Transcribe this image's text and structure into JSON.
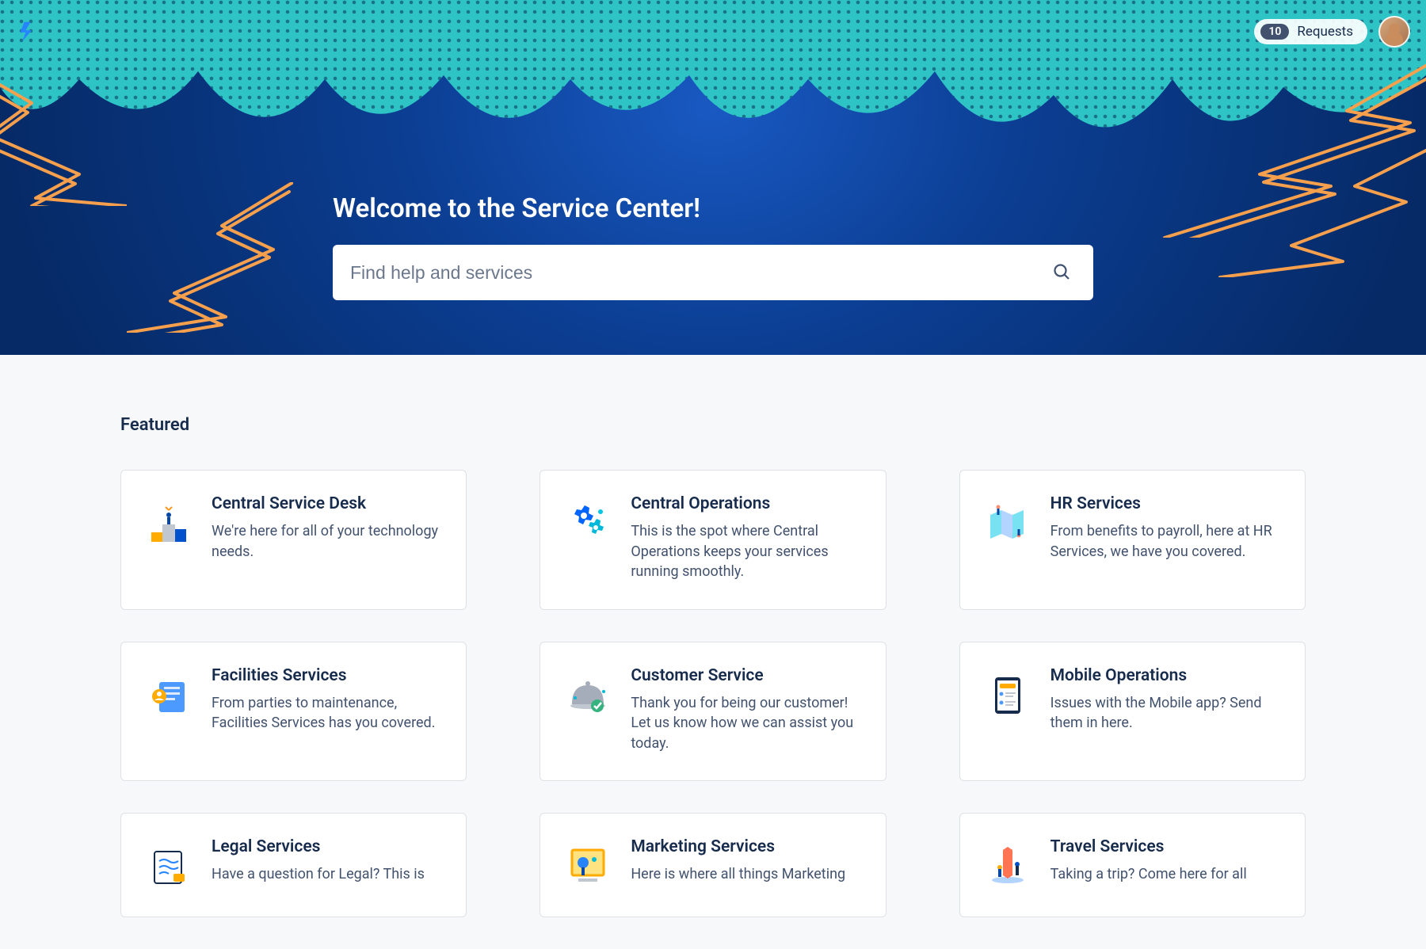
{
  "header": {
    "requests_count": "10",
    "requests_label": "Requests"
  },
  "hero": {
    "title": "Welcome to the Service Center!",
    "search_placeholder": "Find help and services"
  },
  "featured": {
    "heading": "Featured",
    "cards": [
      {
        "icon": "podium",
        "title": "Central Service Desk",
        "desc": "We're here for all of your technology needs."
      },
      {
        "icon": "gears",
        "title": "Central Operations",
        "desc": "This is the spot where Central Operations keeps your services running smoothly."
      },
      {
        "icon": "hr",
        "title": "HR Services",
        "desc": "From benefits to payroll, here at HR Services, we have you covered."
      },
      {
        "icon": "facilities",
        "title": "Facilities Services",
        "desc": "From parties to maintenance, Facilities Services has you covered."
      },
      {
        "icon": "cloche",
        "title": "Customer Service",
        "desc": "Thank you for being our customer! Let us know how we can assist you today."
      },
      {
        "icon": "mobile",
        "title": "Mobile Operations",
        "desc": "Issues with the Mobile app? Send them in here."
      },
      {
        "icon": "legal",
        "title": "Legal Services",
        "desc": "Have a question for Legal? This is"
      },
      {
        "icon": "marketing",
        "title": "Marketing Services",
        "desc": "Here is where all things Marketing"
      },
      {
        "icon": "travel",
        "title": "Travel Services",
        "desc": "Taking a trip? Come here for all"
      }
    ]
  }
}
